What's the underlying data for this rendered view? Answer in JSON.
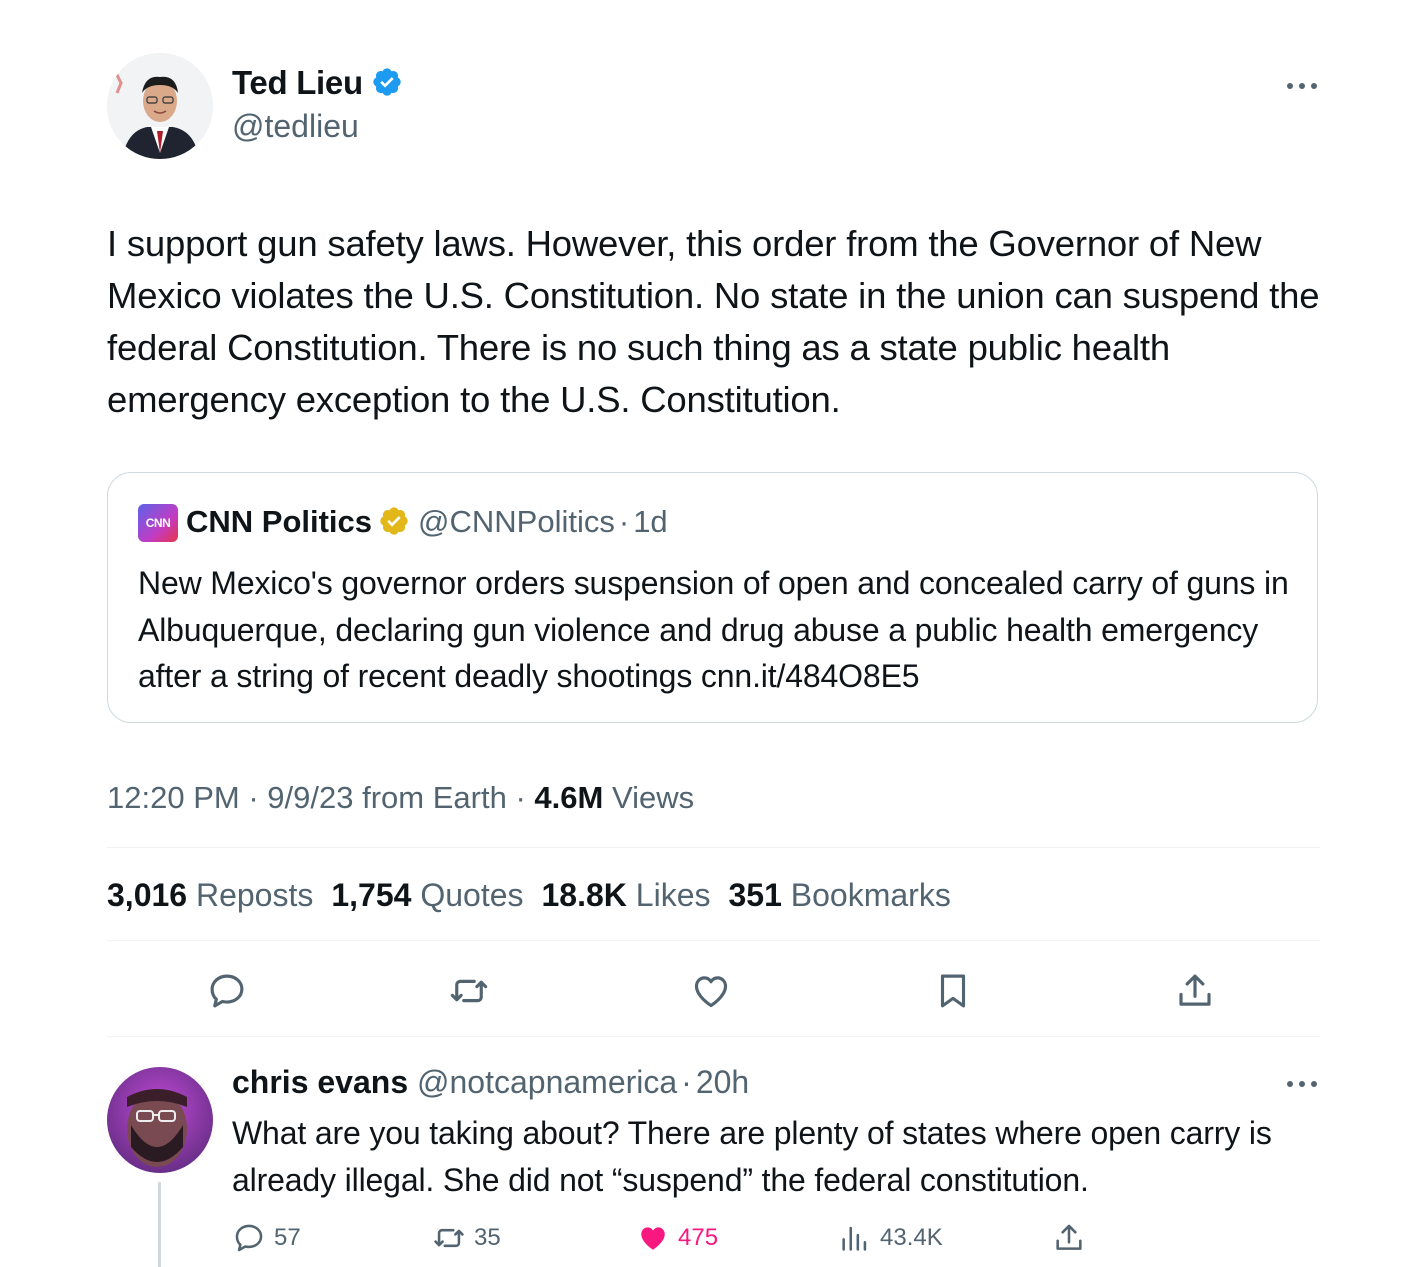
{
  "tweet": {
    "author_name": "Ted Lieu",
    "author_handle": "@tedlieu",
    "text": "I support gun safety laws. However, this order from the Governor of New Mexico violates the U.S. Constitution. No state in the union can suspend the federal Constitution. There is no such thing as a state public health emergency exception to the U.S. Constitution.",
    "time": "12:20 PM",
    "date": "9/9/23",
    "source": "from Earth",
    "sep": "·",
    "views_count": "4.6M",
    "views_label": "Views",
    "stats": {
      "reposts_count": "3,016",
      "reposts_label": "Reposts",
      "quotes_count": "1,754",
      "quotes_label": "Quotes",
      "likes_count": "18.8K",
      "likes_label": "Likes",
      "bookmarks_count": "351",
      "bookmarks_label": "Bookmarks"
    }
  },
  "quote": {
    "logo_text": "CNN",
    "name": "CNN Politics",
    "handle": "@CNNPolitics",
    "sep": "·",
    "age": "1d",
    "text": "New Mexico's governor orders suspension of open and concealed carry of guns in Albuquerque, declaring gun violence and drug abuse a public health emergency after a string of recent deadly shootings cnn.it/484O8E5"
  },
  "reply": {
    "name": "chris evans",
    "handle": "@notcapnamerica",
    "sep": "·",
    "age": "20h",
    "text": "What are you taking about? There are plenty of states where open carry is already illegal. She did not “suspend” the federal constitution.",
    "replies": "57",
    "reposts": "35",
    "likes": "475",
    "views": "43.4K"
  },
  "colors": {
    "verified_blue": "#1d9bf0",
    "verified_gold": "#e2b719",
    "muted": "#536471",
    "like_pink": "#f91880"
  },
  "icons": [
    "verified-badge-icon",
    "more-icon",
    "reply-icon",
    "repost-icon",
    "like-icon",
    "bookmark-icon",
    "share-icon",
    "views-icon"
  ]
}
